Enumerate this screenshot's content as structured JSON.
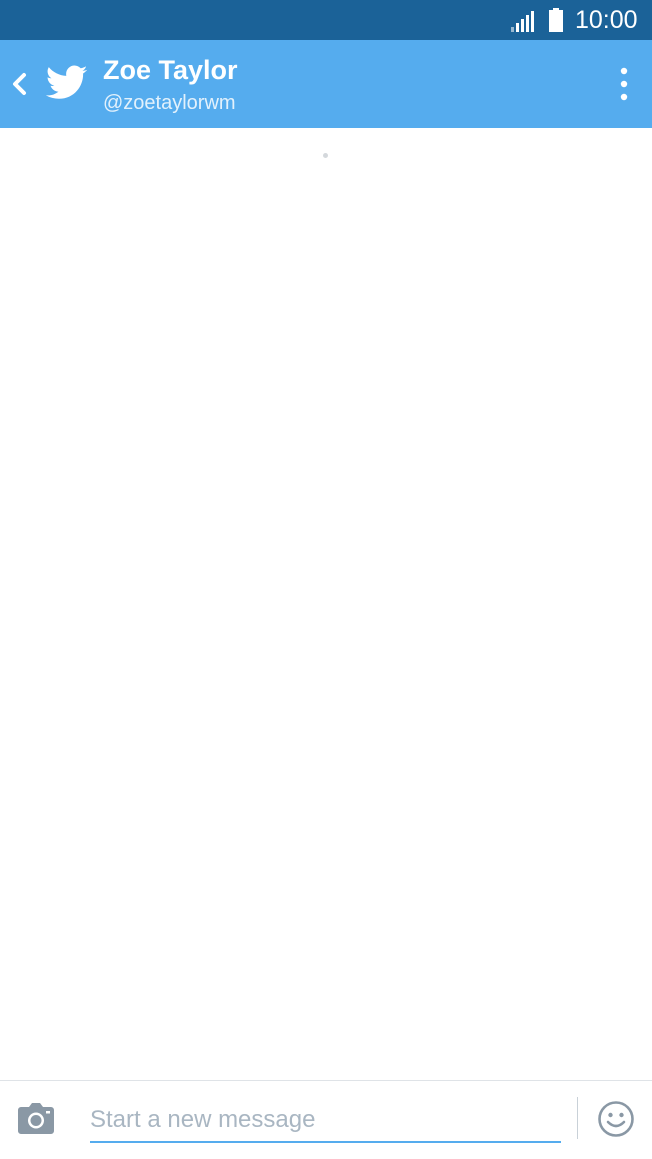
{
  "status_bar": {
    "time": "10:00",
    "signal_icon": "cellular-signal-icon",
    "battery_icon": "battery-icon"
  },
  "header": {
    "back_icon": "chevron-left-icon",
    "logo_icon": "twitter-bird-icon",
    "title": "Zoe Taylor",
    "subtitle": "@zoetaylorwm",
    "menu_icon": "more-vertical-icon"
  },
  "compose": {
    "camera_icon": "camera-icon",
    "placeholder": "Start a new message",
    "value": "",
    "emoji_icon": "smiley-icon"
  },
  "colors": {
    "status_bar": "#1b6298",
    "action_bar": "#55acee",
    "accent": "#55acee",
    "background": "#ffffff"
  }
}
